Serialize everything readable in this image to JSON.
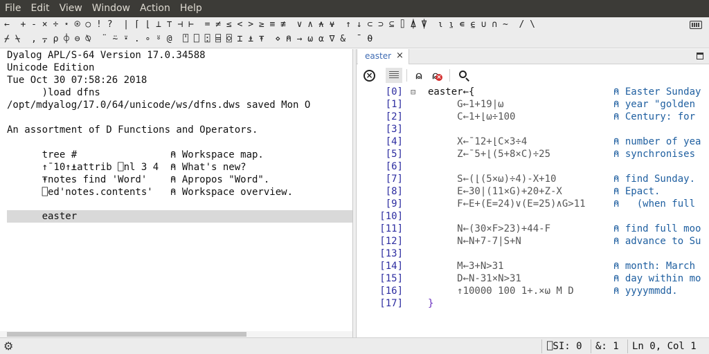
{
  "menubar": {
    "items": [
      "File",
      "Edit",
      "View",
      "Window",
      "Action",
      "Help"
    ]
  },
  "langbar": {
    "row1": "←  + - × ÷ ⋆ ⍟ ○ ! ?  | ⌈ ⌊ ⊥ ⊤ ⊣ ⊢  = ≠ ≤ < > ≥ ≡ ≢  ∨ ∧ ⍲ ⍱  ↑ ↓ ⊂ ⊃ ⊆ ⌷ ⍋ ⍒  ⍳ ⍸ ∊ ⍷ ∪ ∩ ~  / \\",
    "row2": "⌿ ⍀  , ⍪ ⍴ ⌽ ⊖ ⍉  ¨ ⍨ ⍣ . ∘ ⍤ @  ⍞ ⎕ ⍠ ⌸ ⌺ ⌶ ⍎ ⍕  ⋄ ⍝ → ⍵ ⍺ ∇ &  ¯ ⍬",
    "keyboard_icon": "keyboard-icon"
  },
  "session": {
    "lines": [
      "Dyalog APL/S-64 Version 17.0.34588",
      "Unicode Edition",
      "Tue Oct 30 07:58:26 2018",
      "      )load dfns",
      "/opt/mdyalog/17.0/64/unicode/ws/dfns.dws saved Mon O",
      "",
      "An assortment of D Functions and Operators.",
      "",
      "      tree #                ⍝ Workspace map.",
      "      ↑¯10↑⍎attrib ⎕nl 3 4  ⍝ What's new?",
      "      ⍕notes find 'Word'    ⍝ Apropos \"Word\".",
      "      ⎕ed'notes.contents'   ⍝ Workspace overview.",
      "",
      "      easter"
    ]
  },
  "editor": {
    "tab_label": "easter",
    "tab_close": "×",
    "toolbar": {
      "close_glyph": "×",
      "comment_glyph": "⍝",
      "uncomment_glyph": "⍝",
      "uncomment_badge": "×"
    },
    "lines": [
      {
        "num": "[0]",
        "fold": "⊟",
        "code": "easter←{",
        "comment": "⍝ Easter Sunday"
      },
      {
        "num": "[1]",
        "fold": "",
        "code": "     G←1+19|⍵",
        "comment": "⍝ year \"golden"
      },
      {
        "num": "[2]",
        "fold": "",
        "code": "     C←1+⌊⍵÷100",
        "comment": "⍝ Century: for"
      },
      {
        "num": "[3]",
        "fold": "",
        "code": "",
        "comment": ""
      },
      {
        "num": "[4]",
        "fold": "",
        "code": "     X←¯12+⌊C×3÷4",
        "comment": "⍝ number of yea"
      },
      {
        "num": "[5]",
        "fold": "",
        "code": "     Z←¯5+⌊(5+8×C)÷25",
        "comment": "⍝ synchronises"
      },
      {
        "num": "[6]",
        "fold": "",
        "code": "",
        "comment": ""
      },
      {
        "num": "[7]",
        "fold": "",
        "code": "     S←(⌊(5×⍵)÷4)-X+10",
        "comment": "⍝ find Sunday."
      },
      {
        "num": "[8]",
        "fold": "",
        "code": "     E←30|(11×G)+20+Z-X",
        "comment": "⍝ Epact."
      },
      {
        "num": "[9]",
        "fold": "",
        "code": "     F←E+(E=24)∨(E=25)∧G>11",
        "comment": "⍝   (when full"
      },
      {
        "num": "[10]",
        "fold": "",
        "code": "",
        "comment": ""
      },
      {
        "num": "[11]",
        "fold": "",
        "code": "     N←(30×F>23)+44-F",
        "comment": "⍝ find full moo"
      },
      {
        "num": "[12]",
        "fold": "",
        "code": "     N←N+7-7|S+N",
        "comment": "⍝ advance to Su"
      },
      {
        "num": "[13]",
        "fold": "",
        "code": "",
        "comment": ""
      },
      {
        "num": "[14]",
        "fold": "",
        "code": "     M←3+N>31",
        "comment": "⍝ month: March"
      },
      {
        "num": "[15]",
        "fold": "",
        "code": "     D←N-31×N>31",
        "comment": "⍝ day within mo"
      },
      {
        "num": "[16]",
        "fold": "",
        "code": "     ↑10000 100 1+.×⍵ M D",
        "comment": "⍝ yyyymmdd."
      },
      {
        "num": "[17]",
        "fold": "",
        "code": "}",
        "comment": ""
      }
    ]
  },
  "statusbar": {
    "si": "⎕SI: 0",
    "amp": "&: 1",
    "position": "Ln 0, Col 1"
  }
}
